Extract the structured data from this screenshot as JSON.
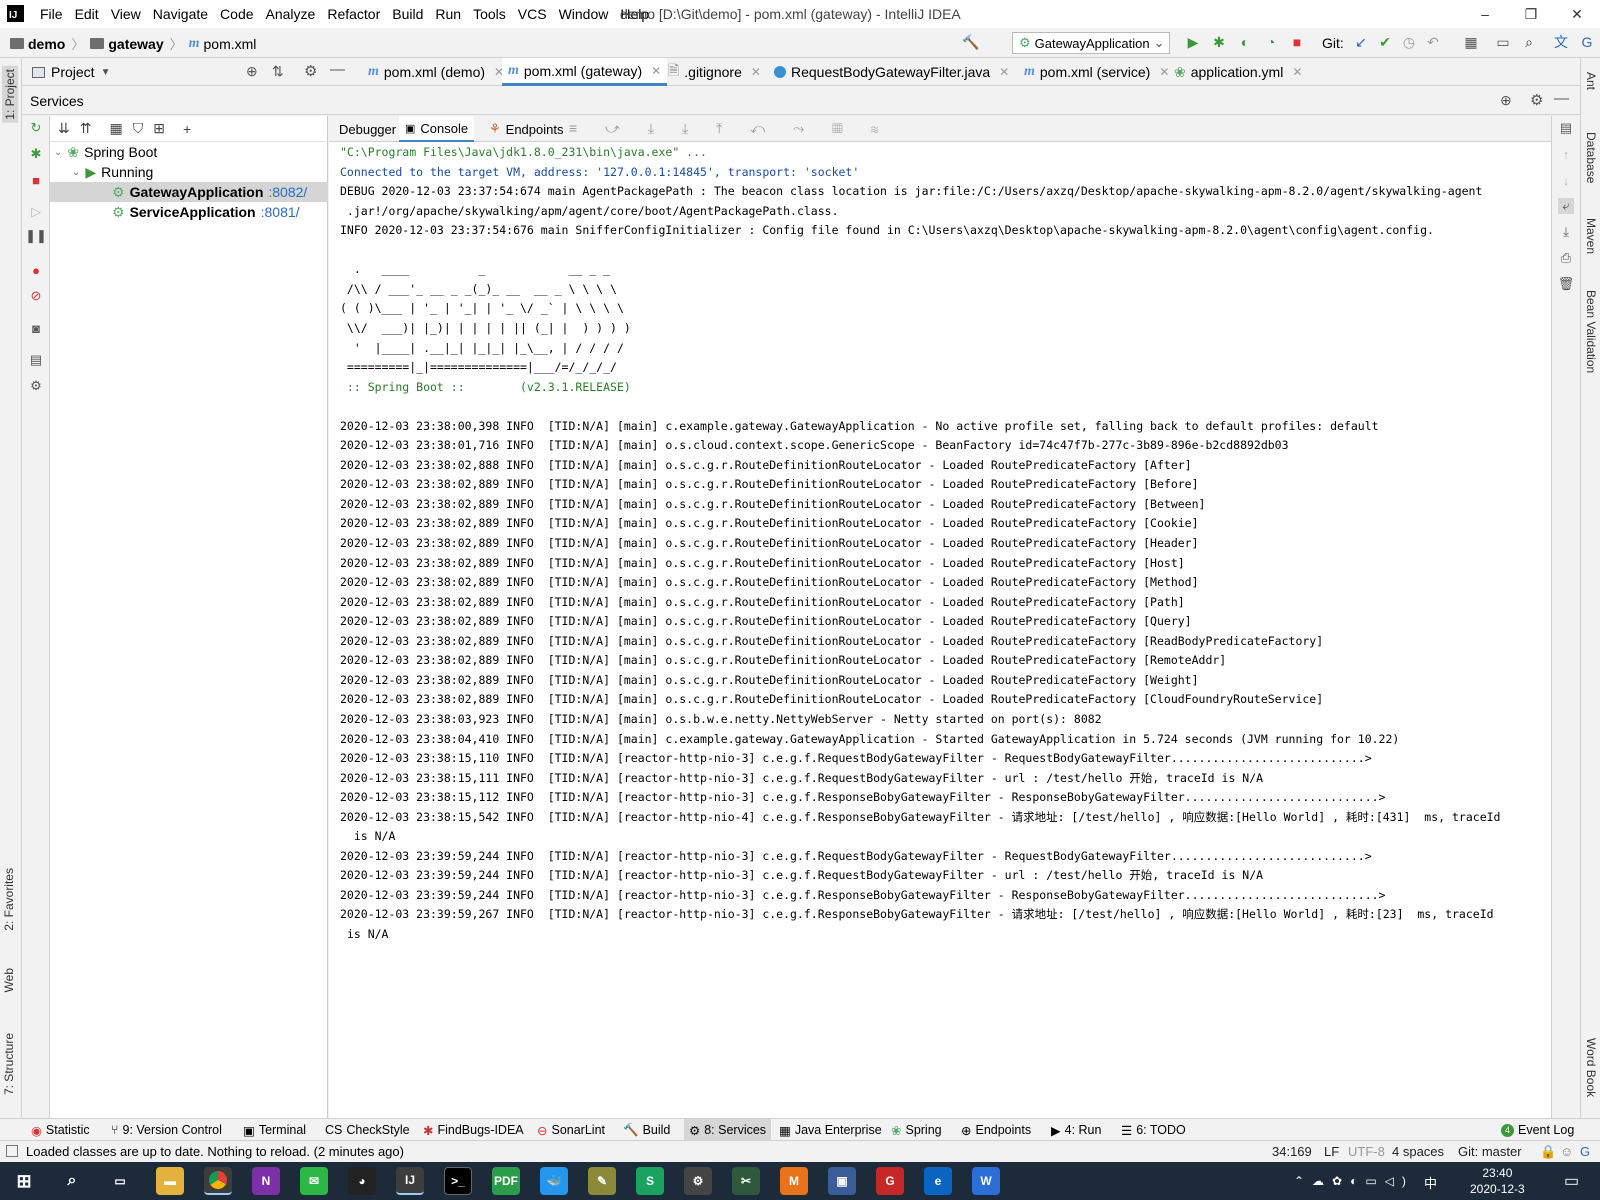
{
  "titlebar": {
    "app_icon": "IJ",
    "menu": [
      "File",
      "Edit",
      "View",
      "Navigate",
      "Code",
      "Analyze",
      "Refactor",
      "Build",
      "Run",
      "Tools",
      "VCS",
      "Window",
      "Help"
    ],
    "window_title": "demo [D:\\Git\\demo] - pom.xml (gateway) - IntelliJ IDEA",
    "minimize": "–",
    "maximize": "❐",
    "close": "✕"
  },
  "navbar": {
    "breadcrumbs": [
      "demo",
      "gateway",
      "pom.xml"
    ],
    "run_config": "GatewayApplication",
    "git_label": "Git:"
  },
  "tool_windows_left": [
    "1: Project",
    "2: Favorites",
    "Web",
    "7: Structure"
  ],
  "tool_windows_right": [
    "Ant",
    "Database",
    "Maven",
    "Bean Validation",
    "Word Book"
  ],
  "project_label": "Project",
  "editor_tabs": [
    {
      "label": "pom.xml (demo)",
      "icon": "maven-icon",
      "active": false
    },
    {
      "label": "pom.xml (gateway)",
      "icon": "maven-icon",
      "active": true
    },
    {
      "label": ".gitignore",
      "icon": "file-icon",
      "active": false
    },
    {
      "label": "RequestBodyGatewayFilter.java",
      "icon": "class-icon",
      "active": false
    },
    {
      "label": "pom.xml (service)",
      "icon": "maven-icon",
      "active": false
    },
    {
      "label": "application.yml",
      "icon": "yaml-icon",
      "active": false
    }
  ],
  "services": {
    "title": "Services",
    "tree": {
      "root": "Spring Boot",
      "group": "Running",
      "apps": [
        {
          "name": "GatewayApplication",
          "port": ":8082/",
          "selected": true
        },
        {
          "name": "ServiceApplication",
          "port": ":8081/",
          "selected": false
        }
      ]
    },
    "console_tabs": [
      "Debugger",
      "Console",
      "Endpoints"
    ]
  },
  "console": {
    "lines": [
      {
        "text": "\"C:\\Program Files\\Java\\jdk1.8.0_231\\bin\\java.exe\" ...",
        "style": "green"
      },
      {
        "text": "Connected to the target VM, address: '127.0.0.1:14845', transport: 'socket'",
        "style": "blue"
      },
      {
        "text": "DEBUG 2020-12-03 23:37:54:674 main AgentPackagePath : The beacon class location is jar:file:/C:/Users/axzq/Desktop/apache-skywalking-apm-8.2.0/agent/skywalking-agent",
        "style": ""
      },
      {
        "text": " .jar!/org/apache/skywalking/apm/agent/core/boot/AgentPackagePath.class.",
        "style": ""
      },
      {
        "text": "INFO 2020-12-03 23:37:54:676 main SnifferConfigInitializer : Config file found in C:\\Users\\axzq\\Desktop\\apache-skywalking-apm-8.2.0\\agent\\config\\agent.config.",
        "style": ""
      },
      {
        "text": "",
        "style": ""
      },
      {
        "text": "  .   ____          _            __ _ _",
        "style": ""
      },
      {
        "text": " /\\\\ / ___'_ __ _ _(_)_ __  __ _ \\ \\ \\ \\",
        "style": ""
      },
      {
        "text": "( ( )\\___ | '_ | '_| | '_ \\/ _` | \\ \\ \\ \\",
        "style": ""
      },
      {
        "text": " \\\\/  ___)| |_)| | | | | || (_| |  ) ) ) )",
        "style": ""
      },
      {
        "text": "  '  |____| .__|_| |_|_| |_\\__, | / / / /",
        "style": ""
      },
      {
        "text": " =========|_|==============|___/=/_/_/_/",
        "style": ""
      },
      {
        "text": " :: Spring Boot ::        (v2.3.1.RELEASE)",
        "style": "green"
      },
      {
        "text": "",
        "style": ""
      },
      {
        "text": "2020-12-03 23:38:00,398 INFO  [TID:N/A] [main] c.example.gateway.GatewayApplication - No active profile set, falling back to default profiles: default",
        "style": ""
      },
      {
        "text": "2020-12-03 23:38:01,716 INFO  [TID:N/A] [main] o.s.cloud.context.scope.GenericScope - BeanFactory id=74c47f7b-277c-3b89-896e-b2cd8892db03",
        "style": ""
      },
      {
        "text": "2020-12-03 23:38:02,888 INFO  [TID:N/A] [main] o.s.c.g.r.RouteDefinitionRouteLocator - Loaded RoutePredicateFactory [After]",
        "style": ""
      },
      {
        "text": "2020-12-03 23:38:02,889 INFO  [TID:N/A] [main] o.s.c.g.r.RouteDefinitionRouteLocator - Loaded RoutePredicateFactory [Before]",
        "style": ""
      },
      {
        "text": "2020-12-03 23:38:02,889 INFO  [TID:N/A] [main] o.s.c.g.r.RouteDefinitionRouteLocator - Loaded RoutePredicateFactory [Between]",
        "style": ""
      },
      {
        "text": "2020-12-03 23:38:02,889 INFO  [TID:N/A] [main] o.s.c.g.r.RouteDefinitionRouteLocator - Loaded RoutePredicateFactory [Cookie]",
        "style": ""
      },
      {
        "text": "2020-12-03 23:38:02,889 INFO  [TID:N/A] [main] o.s.c.g.r.RouteDefinitionRouteLocator - Loaded RoutePredicateFactory [Header]",
        "style": ""
      },
      {
        "text": "2020-12-03 23:38:02,889 INFO  [TID:N/A] [main] o.s.c.g.r.RouteDefinitionRouteLocator - Loaded RoutePredicateFactory [Host]",
        "style": ""
      },
      {
        "text": "2020-12-03 23:38:02,889 INFO  [TID:N/A] [main] o.s.c.g.r.RouteDefinitionRouteLocator - Loaded RoutePredicateFactory [Method]",
        "style": ""
      },
      {
        "text": "2020-12-03 23:38:02,889 INFO  [TID:N/A] [main] o.s.c.g.r.RouteDefinitionRouteLocator - Loaded RoutePredicateFactory [Path]",
        "style": ""
      },
      {
        "text": "2020-12-03 23:38:02,889 INFO  [TID:N/A] [main] o.s.c.g.r.RouteDefinitionRouteLocator - Loaded RoutePredicateFactory [Query]",
        "style": ""
      },
      {
        "text": "2020-12-03 23:38:02,889 INFO  [TID:N/A] [main] o.s.c.g.r.RouteDefinitionRouteLocator - Loaded RoutePredicateFactory [ReadBodyPredicateFactory]",
        "style": ""
      },
      {
        "text": "2020-12-03 23:38:02,889 INFO  [TID:N/A] [main] o.s.c.g.r.RouteDefinitionRouteLocator - Loaded RoutePredicateFactory [RemoteAddr]",
        "style": ""
      },
      {
        "text": "2020-12-03 23:38:02,889 INFO  [TID:N/A] [main] o.s.c.g.r.RouteDefinitionRouteLocator - Loaded RoutePredicateFactory [Weight]",
        "style": ""
      },
      {
        "text": "2020-12-03 23:38:02,889 INFO  [TID:N/A] [main] o.s.c.g.r.RouteDefinitionRouteLocator - Loaded RoutePredicateFactory [CloudFoundryRouteService]",
        "style": ""
      },
      {
        "text": "2020-12-03 23:38:03,923 INFO  [TID:N/A] [main] o.s.b.w.e.netty.NettyWebServer - Netty started on port(s): 8082",
        "style": ""
      },
      {
        "text": "2020-12-03 23:38:04,410 INFO  [TID:N/A] [main] c.example.gateway.GatewayApplication - Started GatewayApplication in 5.724 seconds (JVM running for 10.22)",
        "style": ""
      },
      {
        "text": "2020-12-03 23:38:15,110 INFO  [TID:N/A] [reactor-http-nio-3] c.e.g.f.RequestBodyGatewayFilter - RequestBodyGatewayFilter............................>",
        "style": ""
      },
      {
        "text": "2020-12-03 23:38:15,111 INFO  [TID:N/A] [reactor-http-nio-3] c.e.g.f.RequestBodyGatewayFilter - url : /test/hello 开始, traceId is N/A",
        "style": ""
      },
      {
        "text": "2020-12-03 23:38:15,112 INFO  [TID:N/A] [reactor-http-nio-3] c.e.g.f.ResponseBobyGatewayFilter - ResponseBobyGatewayFilter............................>",
        "style": ""
      },
      {
        "text": "2020-12-03 23:38:15,542 INFO  [TID:N/A] [reactor-http-nio-4] c.e.g.f.ResponseBobyGatewayFilter - 请求地址: [/test/hello] , 响应数据:[Hello World] , 耗时:[431]  ms, traceId",
        "style": ""
      },
      {
        "text": "  is N/A",
        "style": ""
      },
      {
        "text": "2020-12-03 23:39:59,244 INFO  [TID:N/A] [reactor-http-nio-3] c.e.g.f.RequestBodyGatewayFilter - RequestBodyGatewayFilter............................>",
        "style": ""
      },
      {
        "text": "2020-12-03 23:39:59,244 INFO  [TID:N/A] [reactor-http-nio-3] c.e.g.f.RequestBodyGatewayFilter - url : /test/hello 开始, traceId is N/A",
        "style": ""
      },
      {
        "text": "2020-12-03 23:39:59,244 INFO  [TID:N/A] [reactor-http-nio-3] c.e.g.f.ResponseBobyGatewayFilter - ResponseBobyGatewayFilter............................>",
        "style": ""
      },
      {
        "text": "2020-12-03 23:39:59,267 INFO  [TID:N/A] [reactor-http-nio-3] c.e.g.f.ResponseBobyGatewayFilter - 请求地址: [/test/hello] , 响应数据:[Hello World] , 耗时:[23]  ms, traceId",
        "style": ""
      },
      {
        "text": " is N/A",
        "style": ""
      }
    ]
  },
  "bottom_tools": [
    {
      "label": "Statistic",
      "active": false
    },
    {
      "label": "9: Version Control",
      "active": false
    },
    {
      "label": "Terminal",
      "active": false
    },
    {
      "label": "CheckStyle",
      "active": false
    },
    {
      "label": "FindBugs-IDEA",
      "active": false
    },
    {
      "label": "SonarLint",
      "active": false
    },
    {
      "label": "Build",
      "active": false
    },
    {
      "label": "8: Services",
      "active": true
    },
    {
      "label": "Java Enterprise",
      "active": false
    },
    {
      "label": "Spring",
      "active": false
    },
    {
      "label": "Endpoints",
      "active": false
    },
    {
      "label": "4: Run",
      "active": false
    },
    {
      "label": "6: TODO",
      "active": false
    },
    {
      "label": "Event Log",
      "active": false
    }
  ],
  "event_log_count": "4",
  "statusbar": {
    "message": "Loaded classes are up to date. Nothing to reload. (2 minutes ago)",
    "position": "34:169",
    "line_sep": "LF",
    "encoding": "UTF-8",
    "indent": "4 spaces",
    "branch": "Git: master"
  },
  "taskbar": {
    "time": "23:40",
    "date": "2020-12-3",
    "ime": "中"
  },
  "colors": {
    "accent": "#4083c9",
    "console_green": "#2a7d2a",
    "console_blue": "#1a4ea0",
    "taskbar": "#1c2a3a"
  }
}
